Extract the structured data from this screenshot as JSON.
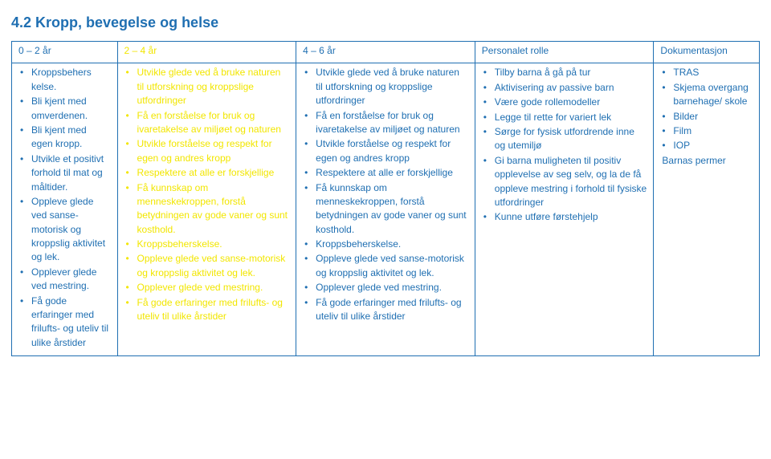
{
  "title": "4.2 Kropp, bevegelse og helse",
  "headers": {
    "col0": "0 – 2 år",
    "col1": "2 – 4 år",
    "col2": "4 – 6 år",
    "col3": "Personalet rolle",
    "col4": "Dokumentasjon"
  },
  "col0": {
    "i0": "Kroppsbehers kelse.",
    "i1": "Bli kjent med omverdenen.",
    "i2": "Bli kjent med egen kropp.",
    "i3": "Utvikle et positivt forhold til mat og måltider.",
    "i4": "Oppleve glede ved sanse-motorisk og kroppslig aktivitet og lek.",
    "i5": "Opplever glede ved mestring.",
    "i6": "Få gode erfaringer med frilufts- og uteliv til ulike årstider"
  },
  "col1": {
    "i0": "Utvikle glede ved å bruke naturen til utforskning og kroppslige utfordringer",
    "i1": "Få en forståelse for bruk og ivaretakelse av miljøet og naturen",
    "i2": "Utvikle forståelse og respekt for egen og andres kropp",
    "i3": "Respektere at alle er forskjellige",
    "i4": "Få kunnskap om menneskekroppen, forstå betydningen av gode vaner og sunt kosthold.",
    "i5": "Kroppsbeherskelse.",
    "i6": "Oppleve glede ved sanse-motorisk og kroppslig aktivitet og lek.",
    "i7": "Opplever glede ved mestring.",
    "i8": "Få gode erfaringer med frilufts- og uteliv til ulike årstider"
  },
  "col2": {
    "i0": "Utvikle glede ved å bruke naturen til utforskning og kroppslige utfordringer",
    "i1": "Få en forståelse for bruk og ivaretakelse av miljøet og naturen",
    "i2": "Utvikle forståelse og respekt for egen og andres kropp",
    "i3": "Respektere at alle er forskjellige",
    "i4": "Få kunnskap om menneskekroppen, forstå betydningen av gode vaner og sunt kosthold.",
    "i5": "Kroppsbeherskelse.",
    "i6": "Oppleve glede ved sanse-motorisk og kroppslig aktivitet og lek.",
    "i7": "Opplever glede ved mestring.",
    "i8": "Få gode erfaringer med frilufts- og uteliv til ulike årstider"
  },
  "col3": {
    "i0": "Tilby barna å gå på tur",
    "i1": "Aktivisering av passive barn",
    "i2": "Være gode rollemodeller",
    "i3": "Legge til rette for variert lek",
    "i4": "Sørge for fysisk utfordrende inne og utemiljø",
    "i5": "Gi barna muligheten til positiv opplevelse av seg selv, og la de få oppleve mestring i forhold til fysiske utfordringer",
    "i6": "Kunne utføre førstehjelp"
  },
  "col4": {
    "i0": "TRAS",
    "i1": "Skjema overgang barnehage/ skole",
    "i2": "Bilder",
    "i3": "Film",
    "i4": "IOP",
    "extra": "Barnas permer"
  }
}
